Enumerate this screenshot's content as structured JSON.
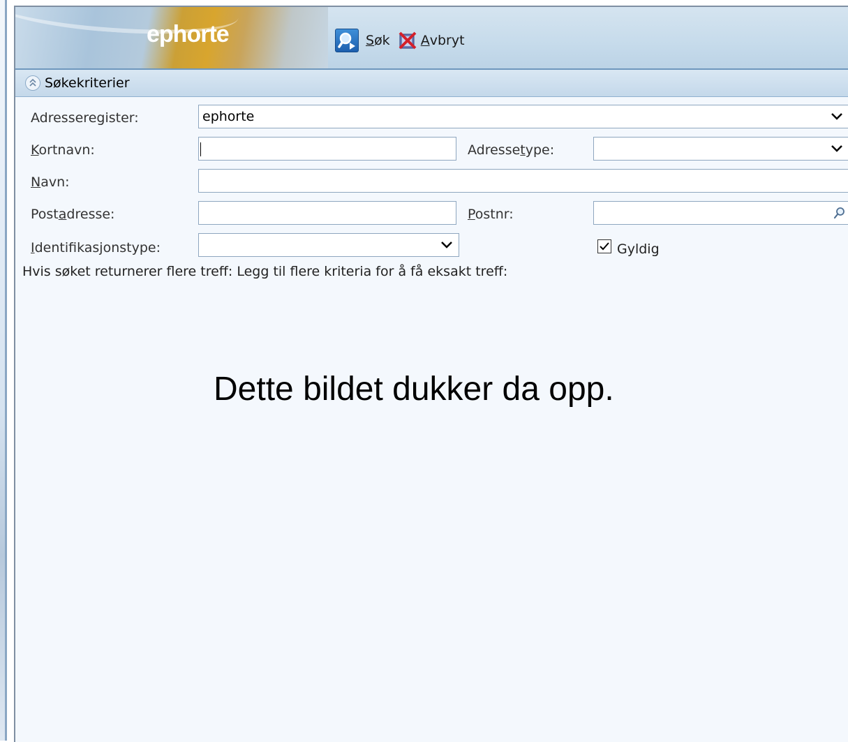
{
  "header": {
    "logo": "ephorte",
    "toolbar": {
      "search_prefix": "S",
      "search_rest": "øk",
      "cancel_prefix": "A",
      "cancel_rest": "vbryt"
    }
  },
  "section": {
    "title": "Søkekriterier"
  },
  "form": {
    "adresseregister": {
      "label": "Adresseregister:",
      "value": "ephorte"
    },
    "kortnavn": {
      "label_ul": "K",
      "label_rest": "ortnavn:",
      "value": ""
    },
    "adressetype": {
      "label_pre": "Adresse",
      "label_ul": "t",
      "label_rest": "ype:",
      "value": ""
    },
    "navn": {
      "label_ul": "N",
      "label_rest": "avn:",
      "value": ""
    },
    "postadresse": {
      "label_pre": "Post",
      "label_ul": "a",
      "label_rest": "dresse:",
      "value": ""
    },
    "postnr": {
      "label_ul": "P",
      "label_rest": "ostnr:",
      "value": ""
    },
    "identifikasjonstype": {
      "label_ul": "I",
      "label_rest": "dentifikasjonstype:",
      "value": ""
    },
    "gyldig": {
      "label": "Gyldig",
      "checked": true
    }
  },
  "hint": "Hvis søket returnerer flere treff: Legg til flere kriteria for å få eksakt treff:",
  "caption": "Dette bildet dukker da opp."
}
